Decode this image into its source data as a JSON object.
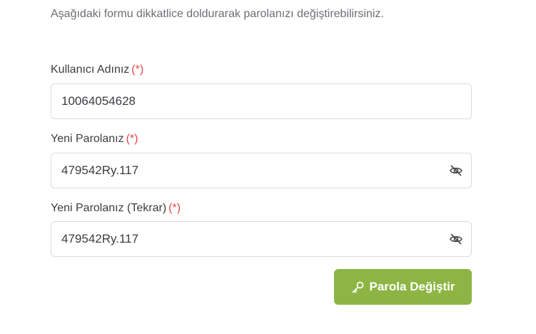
{
  "intro_text": "Aşağıdaki formu dikkatlice doldurarak parolanızı değiştirebilirsiniz.",
  "fields": [
    {
      "label": "Kullanıcı Adınız",
      "required_marker": "(*)",
      "value": "10064054628",
      "type": "text"
    },
    {
      "label": "Yeni Parolanız",
      "required_marker": "(*)",
      "value": "479542Ry.117",
      "type": "password-visible",
      "toggle_icon": "eye-slash-icon"
    },
    {
      "label": "Yeni Parolanız (Tekrar)",
      "required_marker": "(*)",
      "value": "479542Ry.117",
      "type": "password-visible",
      "toggle_icon": "eye-slash-icon"
    }
  ],
  "submit_button": {
    "label": "Parola Değiştir",
    "icon": "key-icon"
  },
  "colors": {
    "accent": "#8db544",
    "required": "#e04848",
    "text": "#3a3d40",
    "muted": "#6b6f73",
    "border": "#d9dcdf"
  }
}
